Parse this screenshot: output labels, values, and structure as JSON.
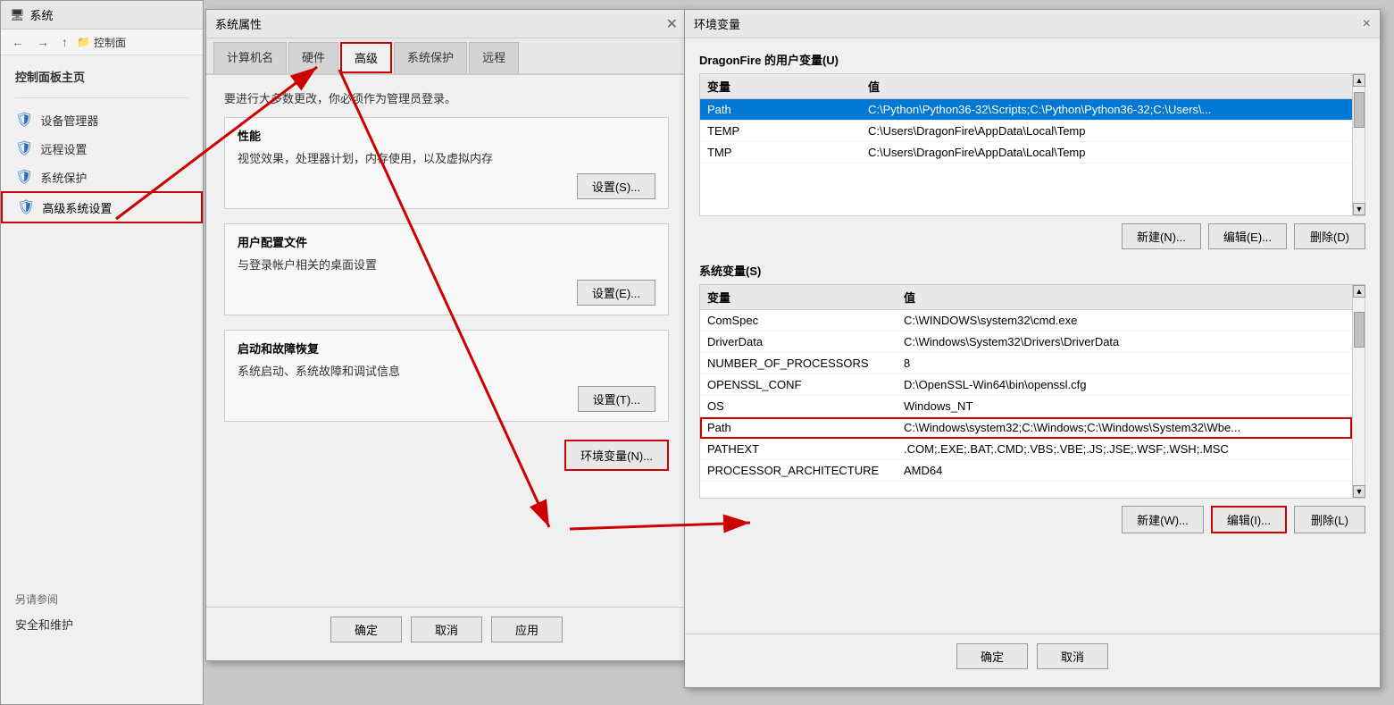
{
  "system_window": {
    "title": "系统",
    "title_icon": "🖥",
    "nav": {
      "back": "←",
      "forward": "→",
      "up": "↑",
      "breadcrumb": "控制面"
    },
    "sidebar_header": "控制面板主页",
    "sidebar_items": [
      {
        "label": "设备管理器",
        "icon": "shield"
      },
      {
        "label": "远程设置",
        "icon": "shield"
      },
      {
        "label": "系统保护",
        "icon": "shield"
      },
      {
        "label": "高级系统设置",
        "icon": "shield",
        "highlighted": true
      }
    ],
    "also_see": "另请参阅",
    "security_maintenance": "安全和维护"
  },
  "sys_props": {
    "title": "系统属性",
    "tabs": [
      {
        "label": "计算机名"
      },
      {
        "label": "硬件"
      },
      {
        "label": "高级",
        "active": true,
        "highlighted": true
      },
      {
        "label": "系统保护"
      },
      {
        "label": "远程"
      }
    ],
    "note": "要进行大多数更改，你必须作为管理员登录。",
    "sections": [
      {
        "title": "性能",
        "desc": "视觉效果，处理器计划，内存使用，以及虚拟内存",
        "btn": "设置(S)..."
      },
      {
        "title": "用户配置文件",
        "desc": "与登录帐户相关的桌面设置",
        "btn": "设置(E)..."
      },
      {
        "title": "启动和故障恢复",
        "desc": "系统启动、系统故障和调试信息",
        "btn": "设置(T)..."
      }
    ],
    "env_btn": "环境变量(N)...",
    "ok_btn": "确定",
    "cancel_btn": "取消",
    "apply_btn": "应用"
  },
  "env_vars": {
    "title": "环境变量",
    "close_btn": "×",
    "user_section_title": "DragonFire 的用户变量(U)",
    "user_table_headers": [
      "变量",
      "值"
    ],
    "user_rows": [
      {
        "var": "Path",
        "val": "C:\\Python\\Python36-32\\Scripts;C:\\Python\\Python36-32;C:\\Users\\...",
        "selected": true
      },
      {
        "var": "TEMP",
        "val": "C:\\Users\\DragonFire\\AppData\\Local\\Temp"
      },
      {
        "var": "TMP",
        "val": "C:\\Users\\DragonFire\\AppData\\Local\\Temp"
      }
    ],
    "user_buttons": [
      "新建(N)...",
      "编辑(E)...",
      "删除(D)"
    ],
    "system_section_title": "系统变量(S)",
    "system_table_headers": [
      "变量",
      "值"
    ],
    "system_rows": [
      {
        "var": "ComSpec",
        "val": "C:\\WINDOWS\\system32\\cmd.exe"
      },
      {
        "var": "DriverData",
        "val": "C:\\Windows\\System32\\Drivers\\DriverData"
      },
      {
        "var": "NUMBER_OF_PROCESSORS",
        "val": "8"
      },
      {
        "var": "OPENSSL_CONF",
        "val": "D:\\OpenSSL-Win64\\bin\\openssl.cfg"
      },
      {
        "var": "OS",
        "val": "Windows_NT"
      },
      {
        "var": "Path",
        "val": "C:\\Windows\\system32;C:\\Windows;C:\\Windows\\System32\\Wbe...",
        "highlighted": true
      },
      {
        "var": "PATHEXT",
        "val": ".COM;.EXE;.BAT;.CMD;.VBS;.VBE;.JS;.JSE;.WSF;.WSH;.MSC"
      },
      {
        "var": "PROCESSOR_ARCHITECTURE",
        "val": "AMD64"
      }
    ],
    "system_buttons": [
      "新建(W)...",
      "编辑(I)...",
      "删除(L)"
    ],
    "ok_btn": "确定",
    "cancel_btn": "取消"
  }
}
